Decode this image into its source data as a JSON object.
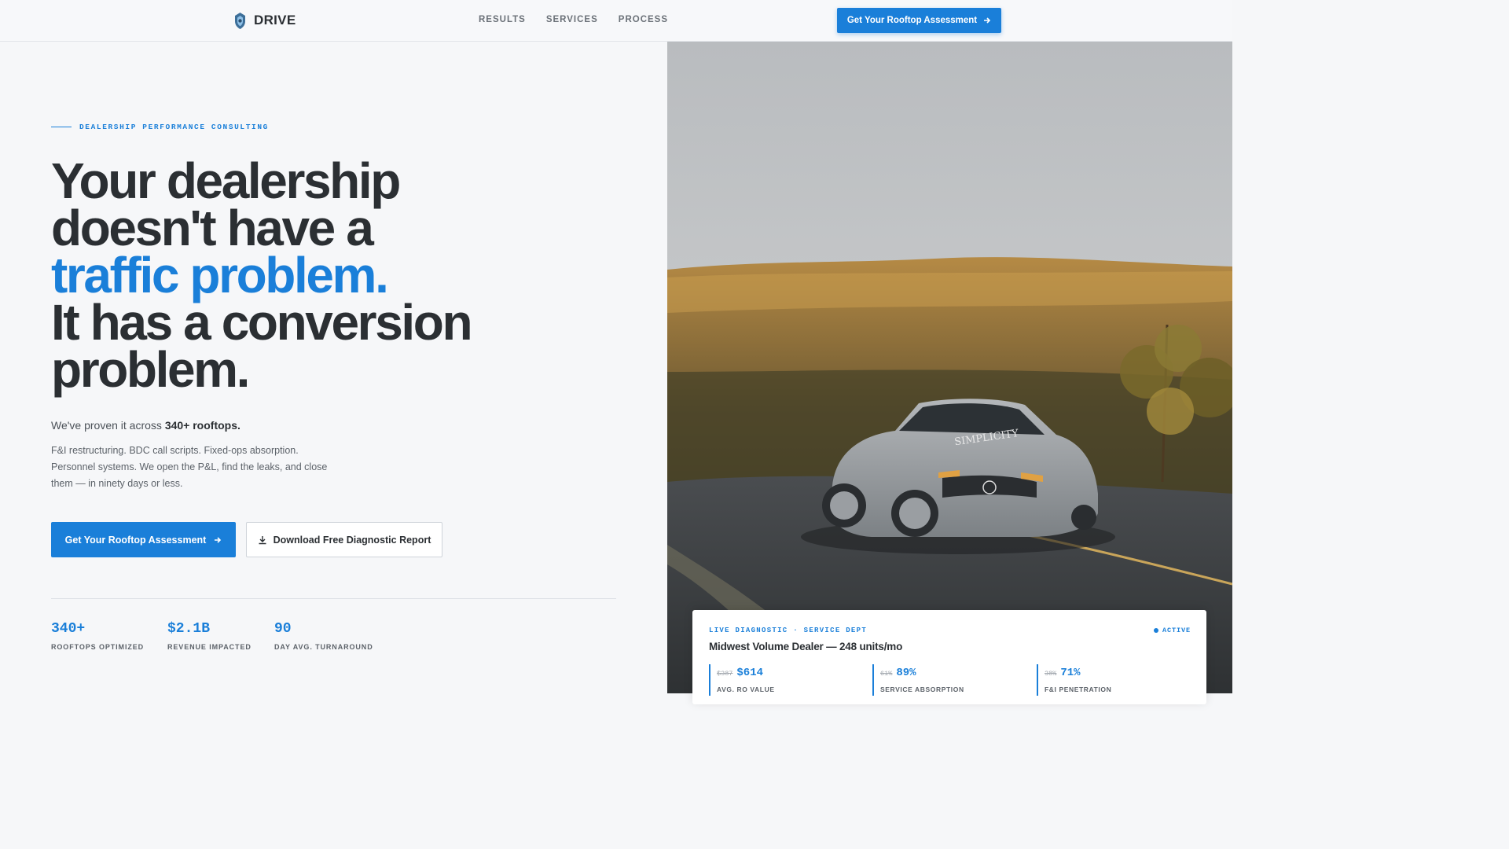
{
  "brand": {
    "name": "DRIVE",
    "accent": "#1a7fd9"
  },
  "nav": {
    "links": [
      "RESULTS",
      "SERVICES",
      "PROCESS"
    ],
    "cta_label": "Get Your Rooftop Assessment"
  },
  "hero": {
    "eyebrow": "DEALERSHIP PERFORMANCE CONSULTING",
    "headline": {
      "line1": "Your dealership",
      "line2": "doesn't have a",
      "line3_accent": "traffic problem.",
      "line4": "It has a conversion",
      "line5": "problem."
    },
    "proof_prefix": "We've proven it across ",
    "proof_strong": "340+ rooftops.",
    "description": "F&I restructuring. BDC call scripts. Fixed-ops absorption. Personnel systems. We open the P&L, find the leaks, and close them — in ninety days or less.",
    "primary_cta": "Get Your Rooftop Assessment",
    "secondary_cta": "Download Free Diagnostic Report"
  },
  "stats": [
    {
      "value": "340+",
      "label": "ROOFTOPS OPTIMIZED"
    },
    {
      "value": "$2.1B",
      "label": "REVENUE IMPACTED"
    },
    {
      "value": "90",
      "label": "DAY AVG. TURNAROUND"
    }
  ],
  "diagnostic": {
    "eyebrow": "LIVE DIAGNOSTIC · SERVICE DEPT",
    "status": "ACTIVE",
    "title": "Midwest Volume Dealer — 248 units/mo",
    "metrics": [
      {
        "old": "$387",
        "new": "$614",
        "label": "AVG. RO VALUE"
      },
      {
        "old": "61%",
        "new": "89%",
        "label": "SERVICE ABSORPTION"
      },
      {
        "old": "38%",
        "new": "71%",
        "label": "F&I PENETRATION"
      }
    ]
  },
  "photo": {
    "car_windshield_text": "SIMPLICITY"
  }
}
